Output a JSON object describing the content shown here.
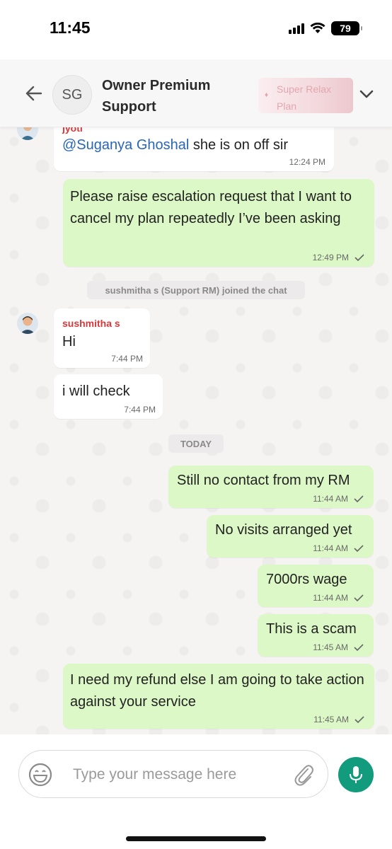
{
  "status": {
    "time": "11:45",
    "battery": "79"
  },
  "header": {
    "avatar_initials": "SG",
    "title": "Owner Premium Support",
    "plan_badge": "Super Relax Plan"
  },
  "messages": [
    {
      "sender": "jyoti",
      "mention": "@Suganya Ghoshal",
      "text": " she is on off sir",
      "time": "12:24 PM"
    },
    {
      "text": "Please raise escalation request that I want to cancel my plan repeatedly I’ve been asking",
      "time": "12:49 PM"
    },
    {
      "sender": "sushmitha s",
      "text": "Hi",
      "time": "7:44 PM"
    },
    {
      "text": "i will check",
      "time": "7:44 PM"
    },
    {
      "text": "Still no contact from my RM",
      "time": "11:44 AM"
    },
    {
      "text": "No visits arranged yet",
      "time": "11:44 AM"
    },
    {
      "text": "7000rs wage",
      "time": "11:44 AM"
    },
    {
      "text": "This is a scam",
      "time": "11:45 AM"
    },
    {
      "text": "I need my refund else I am going to take action against your service",
      "time": "11:45 AM"
    }
  ],
  "system": {
    "joined": "sushmitha s (Support RM) joined the chat",
    "today": "TODAY"
  },
  "input": {
    "placeholder": "Type your message here"
  },
  "colors": {
    "outgoing_bubble": "#dcf8c6",
    "incoming_bubble": "#ffffff",
    "mic_button": "#139b7d",
    "sender_name": "#d9383a",
    "mention": "#2a66b8"
  }
}
